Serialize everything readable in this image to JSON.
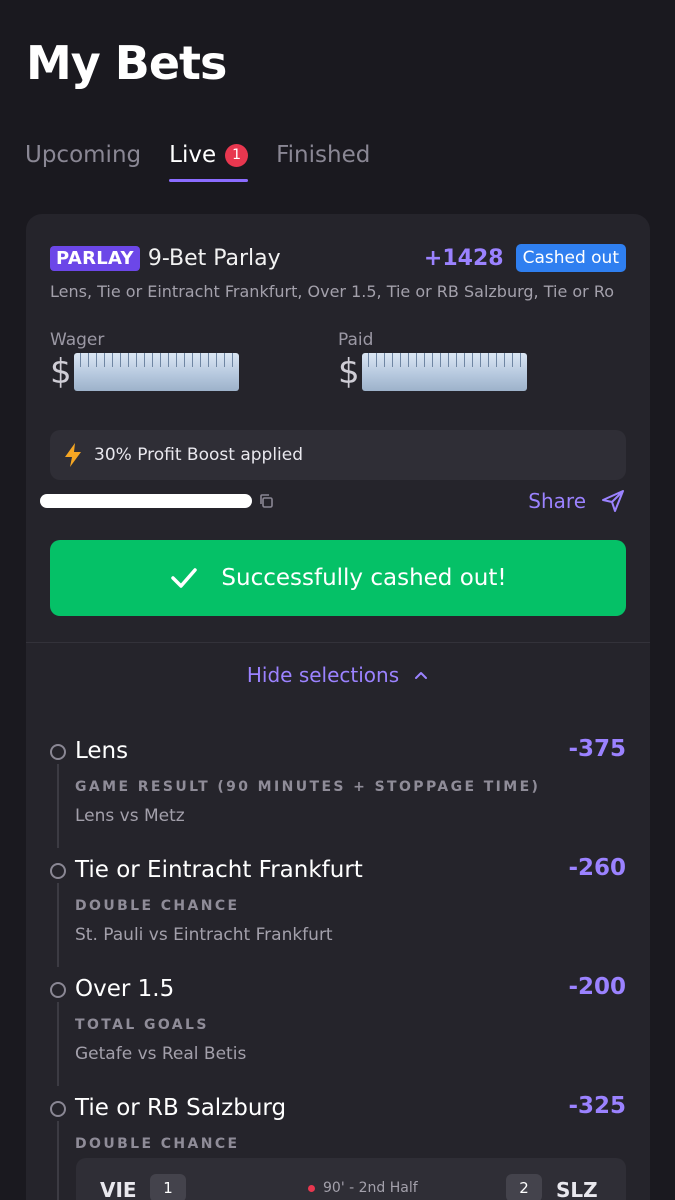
{
  "header": {
    "title": "My Bets"
  },
  "tabs": [
    {
      "label": "Upcoming"
    },
    {
      "label": "Live",
      "badge": "1"
    },
    {
      "label": "Finished"
    }
  ],
  "bet": {
    "tag": "PARLAY",
    "name": "9-Bet Parlay",
    "odds": "+1428",
    "status": "Cashed out",
    "legs_summary": "Lens, Tie or Eintracht Frankfurt, Over 1.5, Tie or RB Salzburg, Tie or Ro",
    "wager_label": "Wager",
    "wager_currency": "$",
    "paid_label": "Paid",
    "paid_currency": "$",
    "boost_text": "30% Profit Boost applied",
    "share_label": "Share",
    "cashout_text": "Successfully cashed out!",
    "hide_selections_label": "Hide selections"
  },
  "legs": [
    {
      "name": "Lens",
      "odds": "-375",
      "market": "GAME RESULT (90 MINUTES + STOPPAGE TIME)",
      "event": "Lens vs Metz"
    },
    {
      "name": "Tie or Eintracht Frankfurt",
      "odds": "-260",
      "market": "DOUBLE CHANCE",
      "event": "St. Pauli vs Eintracht Frankfurt"
    },
    {
      "name": "Over 1.5",
      "odds": "-200",
      "market": "TOTAL GOALS",
      "event": "Getafe vs Real Betis"
    },
    {
      "name": "Tie or RB Salzburg",
      "odds": "-325",
      "market": "DOUBLE CHANCE",
      "event": ""
    }
  ],
  "live_match": {
    "home": "VIE",
    "home_score": "1",
    "status": "90' - 2nd Half",
    "away_score": "2",
    "away": "SLZ"
  },
  "colors": {
    "background": "#1a191f",
    "card": "#25242b",
    "accent": "#9b82ff",
    "parlay_tag": "#6c47e8",
    "cashed_out_badge": "#2f7ff0",
    "success": "#05c167",
    "live_badge": "#e8374f"
  }
}
